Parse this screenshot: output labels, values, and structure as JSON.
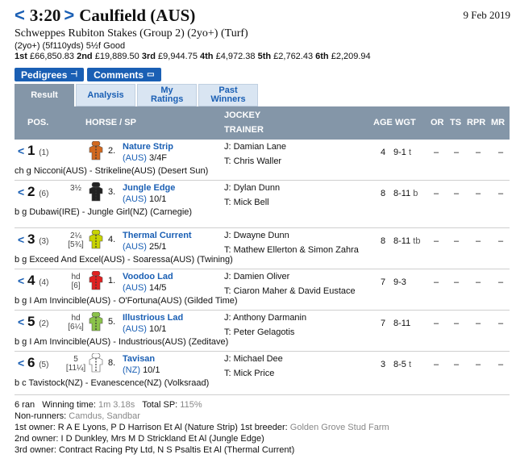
{
  "header": {
    "prev_arrow": "<",
    "time": "3:20",
    "next_arrow": ">",
    "course": "Caulfield (AUS)",
    "date": "9 Feb 2019"
  },
  "race": {
    "name": "Schweppes Rubiton Stakes (Group 2) (2yo+) (Turf)",
    "conditions": "(2yo+) (5f110yds) 5½f Good",
    "prizes": [
      {
        "label": "1st",
        "value": "£66,850.83"
      },
      {
        "label": "2nd",
        "value": "£19,889.50"
      },
      {
        "label": "3rd",
        "value": "£9,944.75"
      },
      {
        "label": "4th",
        "value": "£4,972.38"
      },
      {
        "label": "5th",
        "value": "£2,762.43"
      },
      {
        "label": "6th",
        "value": "£2,209.94"
      }
    ]
  },
  "buttons": {
    "pedigrees": "Pedigrees",
    "comments": "Comments"
  },
  "tabs": [
    {
      "label": "Result"
    },
    {
      "label": "Analysis"
    },
    {
      "label": "My Ratings"
    },
    {
      "label": "Past Winners"
    }
  ],
  "columns": {
    "pos": "POS.",
    "horse": "HORSE / SP",
    "jockey": "JOCKEY",
    "trainer": "TRAINER",
    "age": "AGE",
    "wgt": "WGT",
    "or": "OR",
    "ts": "TS",
    "rpr": "RPR",
    "mr": "MR"
  },
  "runners": [
    {
      "pos": "1",
      "draw": "(1)",
      "dist1": "",
      "dist2": "",
      "num": "2.",
      "horse": "Nature Strip",
      "country": "(AUS)",
      "sp": "3/4F",
      "jockey": "J: Damian Lane",
      "trainer": "T: Chris Waller",
      "age": "4",
      "wgt": "9-1",
      "hg": "t",
      "or": "–",
      "ts": "–",
      "rpr": "–",
      "mr": "–",
      "pedigree": "ch g Nicconi(AUS) - Strikeline(AUS) (Desert Sun)",
      "silk": "#d2691e"
    },
    {
      "pos": "2",
      "draw": "(6)",
      "dist1": "3½",
      "dist2": "",
      "num": "3.",
      "horse": "Jungle Edge",
      "country": "(AUS)",
      "sp": "10/1",
      "jockey": "J: Dylan Dunn",
      "trainer": "T: Mick Bell",
      "age": "8",
      "wgt": "8-11",
      "hg": "b",
      "or": "–",
      "ts": "–",
      "rpr": "–",
      "mr": "–",
      "pedigree": "b g Dubawi(IRE) - Jungle Girl(NZ) (Carnegie)",
      "silk": "#222222"
    },
    {
      "pos": "3",
      "draw": "(3)",
      "dist1": "2¼",
      "dist2": "[5¾]",
      "num": "4.",
      "horse": "Thermal Current",
      "country": "(AUS)",
      "sp": "25/1",
      "jockey": "J: Dwayne Dunn",
      "trainer": "T: Mathew Ellerton & Simon Zahra",
      "age": "8",
      "wgt": "8-11",
      "hg": "tb",
      "or": "–",
      "ts": "–",
      "rpr": "–",
      "mr": "–",
      "pedigree": "b g Exceed And Excel(AUS) - Soaressa(AUS) (Twining)",
      "silk": "#c8d400"
    },
    {
      "pos": "4",
      "draw": "(4)",
      "dist1": "hd",
      "dist2": "[6]",
      "num": "1.",
      "horse": "Voodoo Lad",
      "country": "(AUS)",
      "sp": "14/5",
      "jockey": "J: Damien Oliver",
      "trainer": "T: Ciaron Maher & David Eustace",
      "age": "7",
      "wgt": "9-3",
      "hg": "",
      "or": "–",
      "ts": "–",
      "rpr": "–",
      "mr": "–",
      "pedigree": "b g I Am Invincible(AUS) - O'Fortuna(AUS) (Gilded Time)",
      "silk": "#e02020"
    },
    {
      "pos": "5",
      "draw": "(2)",
      "dist1": "hd",
      "dist2": "[6¼]",
      "num": "5.",
      "horse": "Illustrious Lad",
      "country": "(AUS)",
      "sp": "10/1",
      "jockey": "J: Anthony Darmanin",
      "trainer": "T: Peter Gelagotis",
      "age": "7",
      "wgt": "8-11",
      "hg": "",
      "or": "–",
      "ts": "–",
      "rpr": "–",
      "mr": "–",
      "pedigree": "b g I Am Invincible(AUS) - Industrious(AUS) (Zeditave)",
      "silk": "#8bc34a"
    },
    {
      "pos": "6",
      "draw": "(5)",
      "dist1": "5",
      "dist2": "[11¼]",
      "num": "8.",
      "horse": "Tavisan",
      "country": "(NZ)",
      "sp": "10/1",
      "jockey": "J: Michael Dee",
      "trainer": "T: Mick Price",
      "age": "3",
      "wgt": "8-5",
      "hg": "t",
      "or": "–",
      "ts": "–",
      "rpr": "–",
      "mr": "–",
      "pedigree": "b c Tavistock(NZ) - Evanescence(NZ) (Volksraad)",
      "silk": "#ffffff"
    }
  ],
  "footer": {
    "ran": "6 ran",
    "winning_time_label": "Winning time:",
    "winning_time": "1m 3.18s",
    "total_sp_label": "Total SP:",
    "total_sp": "115%",
    "nonrunners_label": "Non-runners:",
    "nonrunners": "Camdus, Sandbar",
    "owner1": "1st owner: R A E Lyons, P D Harrison Et Al (Nature Strip) 1st breeder:",
    "breeder1": "Golden Grove Stud Farm",
    "owner2": "2nd owner: I D Dunkley, Mrs M D Strickland Et Al (Jungle Edge)",
    "owner3": "3rd owner: Contract Racing Pty Ltd, N S Psaltis Et Al (Thermal Current)"
  },
  "colors": {
    "accent": "#1a5fb4",
    "header_bg": "#8496a8",
    "tab_bg": "#d9e5f2"
  }
}
